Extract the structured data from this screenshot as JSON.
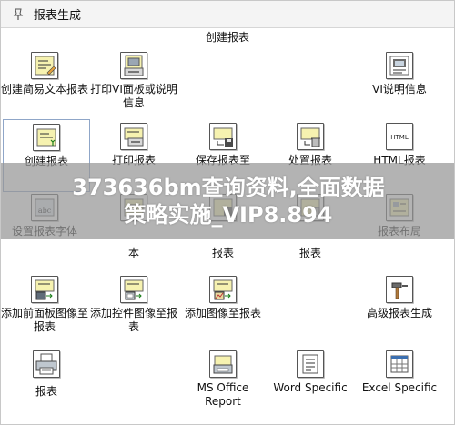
{
  "window": {
    "title": "报表生成"
  },
  "section_title": "创建报表",
  "items": [
    {
      "id": "create-easy-report",
      "label": "创建简易文本报表",
      "icon": "easy-text-report-icon"
    },
    {
      "id": "print-vi-panel",
      "label": "打印VI面板或说明信息",
      "icon": "print-panel-icon"
    },
    {
      "id": "vi-doc-info",
      "label": "VI说明信息",
      "icon": "vi-documentation-icon"
    },
    {
      "id": "create-report",
      "label": "创建报表",
      "icon": "create-report-icon",
      "selected": true
    },
    {
      "id": "print-report",
      "label": "打印报表",
      "icon": "print-report-icon"
    },
    {
      "id": "save-report",
      "label": "保存报表至",
      "icon": "save-report-icon"
    },
    {
      "id": "dispose-report",
      "label": "处置报表",
      "icon": "dispose-report-icon"
    },
    {
      "id": "html-report",
      "label": "HTML报表",
      "icon": "html-icon"
    },
    {
      "id": "set-report-font",
      "label": "设置报表字体",
      "icon": "report-font-icon"
    },
    {
      "id": "append-text",
      "label": "本",
      "icon": "append-text-icon"
    },
    {
      "id": "save-report-2",
      "label": "报表",
      "icon": "save-report-file-icon"
    },
    {
      "id": "dispose-report-2",
      "label": "报表",
      "icon": "dispose-report-file-icon"
    },
    {
      "id": "report-layout",
      "label": "报表布局",
      "icon": "report-layout-icon"
    },
    {
      "id": "append-panel-image",
      "label": "添加前面板图像至报表",
      "icon": "panel-image-icon"
    },
    {
      "id": "append-control-image",
      "label": "添加控件图像至报表",
      "icon": "control-image-icon"
    },
    {
      "id": "append-image",
      "label": "添加图像至报表",
      "icon": "image-icon"
    },
    {
      "id": "advanced-report",
      "label": "高级报表生成",
      "icon": "hammer-icon"
    },
    {
      "id": "report",
      "label": "报表",
      "icon": "printer-icon"
    },
    {
      "id": "ms-office-report",
      "label": "MS Office Report",
      "icon": "ms-office-icon"
    },
    {
      "id": "word-specific",
      "label": "Word Specific",
      "icon": "word-document-icon"
    },
    {
      "id": "excel-specific",
      "label": "Excel Specific",
      "icon": "excel-grid-icon"
    }
  ],
  "banner": {
    "line1": "373636bm查询资料,全面数据",
    "line2": "策略实施_VIP8.894"
  }
}
